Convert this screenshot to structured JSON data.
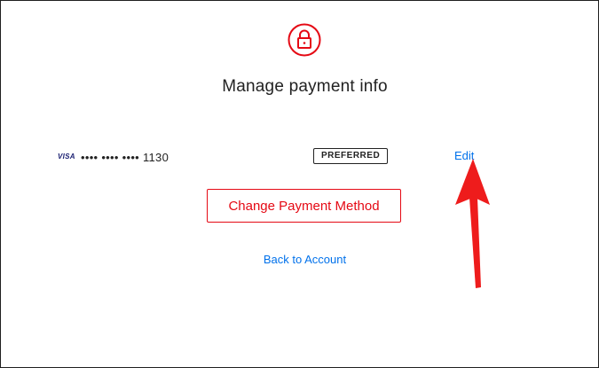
{
  "header": {
    "icon": "lock-icon",
    "title": "Manage payment info"
  },
  "payment_method": {
    "card_brand": "VISA",
    "masked_number": "•••• •••• •••• 1130",
    "badge": "PREFERRED",
    "edit_label": "Edit"
  },
  "actions": {
    "change_payment_label": "Change Payment Method",
    "back_label": "Back to Account"
  },
  "colors": {
    "brand_red": "#e50914",
    "link_blue": "#0071eb",
    "annotation_red": "#ee1c1c",
    "text": "#222222"
  }
}
